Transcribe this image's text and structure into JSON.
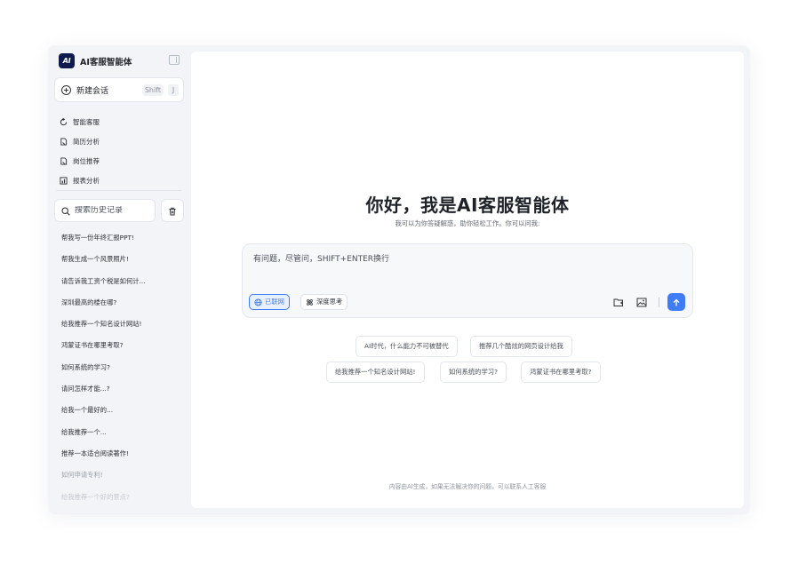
{
  "app": {
    "logo_text": "AI",
    "name": "AI客服智能体"
  },
  "sidebar": {
    "new_chat": {
      "label": "新建会话",
      "shortcut_1": "Shift",
      "shortcut_2": "J"
    },
    "nav": [
      {
        "label": "智能客服",
        "icon": "refresh-icon"
      },
      {
        "label": "简历分析",
        "icon": "document-icon"
      },
      {
        "label": "岗位推荐",
        "icon": "document-icon"
      },
      {
        "label": "报表分析",
        "icon": "chart-icon"
      }
    ],
    "search": {
      "placeholder": "搜索历史记录"
    },
    "history": [
      "帮我写一份年终汇报PPT!",
      "帮我生成一个风景照片!",
      "请告诉我工资个税是如何计...",
      "深圳最高的楼在哪?",
      "给我推荐一个知名设计网站!",
      "鸿蒙证书在哪里考取?",
      "如何系统的学习?",
      "请问怎样才能...?",
      "给我一个最好的...",
      "给我推荐一个...",
      "推荐一本适合阅读著作!",
      "如何申请专利!",
      "给我推荐一个好的景点?"
    ]
  },
  "main": {
    "title": "你好，我是AI客服智能体",
    "subtitle": "我可以为你答疑解惑，助你轻松工作。你可以问我:",
    "composer": {
      "placeholder": "有问题，尽管问，SHIFT+ENTER换行",
      "web_chip": "已联网",
      "deep_chip": "深度思考"
    },
    "suggestions": [
      "AI时代，什么能力不可被替代",
      "推荐几个酷炫的网页设计给我",
      "给我推荐一个知名设计网站!",
      "如何系统的学习?",
      "鸿蒙证书在哪里考取?"
    ],
    "footer": "内容由AI生成，如果无法解决你的问题，可以联系人工客服"
  },
  "colors": {
    "accent": "#3f7cf6",
    "logo_bg": "#0e1b4d",
    "sidebar_bg": "#f3f4f7"
  }
}
